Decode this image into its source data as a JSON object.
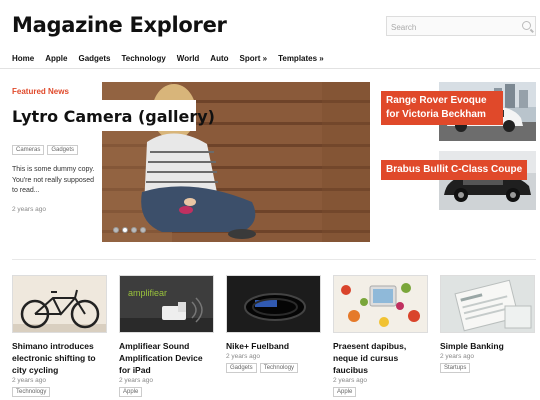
{
  "site": {
    "title": "Magazine Explorer"
  },
  "search": {
    "placeholder": "Search"
  },
  "nav": [
    "Home",
    "Apple",
    "Gadgets",
    "Technology",
    "World",
    "Auto",
    "Sport »",
    "Templates »"
  ],
  "featured": {
    "label": "Featured News",
    "title": "Lytro Camera (gallery)",
    "tags": [
      "Cameras",
      "Gadgets"
    ],
    "excerpt": "This is some dummy copy. You're not really supposed to read...",
    "time": "2 years ago"
  },
  "side_items": [
    {
      "title": "Range Rover Evoque for Victoria Beckham"
    },
    {
      "title": "Brabus Bullit C-Class Coupe"
    }
  ],
  "cards": [
    {
      "title": "Shimano introduces electronic shifting to city cycling",
      "time": "2 years ago",
      "tags": [
        "Technology"
      ]
    },
    {
      "title": "Amplifiear Sound Amplification Device for iPad",
      "time": "2 years ago",
      "tags": [
        "Apple"
      ],
      "thumb_text": "amplifiear"
    },
    {
      "title": "Nike+ Fuelband",
      "time": "2 years ago",
      "tags": [
        "Gadgets",
        "Technology"
      ]
    },
    {
      "title": "Praesent dapibus, neque id cursus faucibus",
      "time": "2 years ago",
      "tags": [
        "Apple"
      ]
    },
    {
      "title": "Simple Banking",
      "time": "2 years ago",
      "tags": [
        "Startups"
      ]
    }
  ],
  "colors": {
    "accent": "#e0492a"
  }
}
